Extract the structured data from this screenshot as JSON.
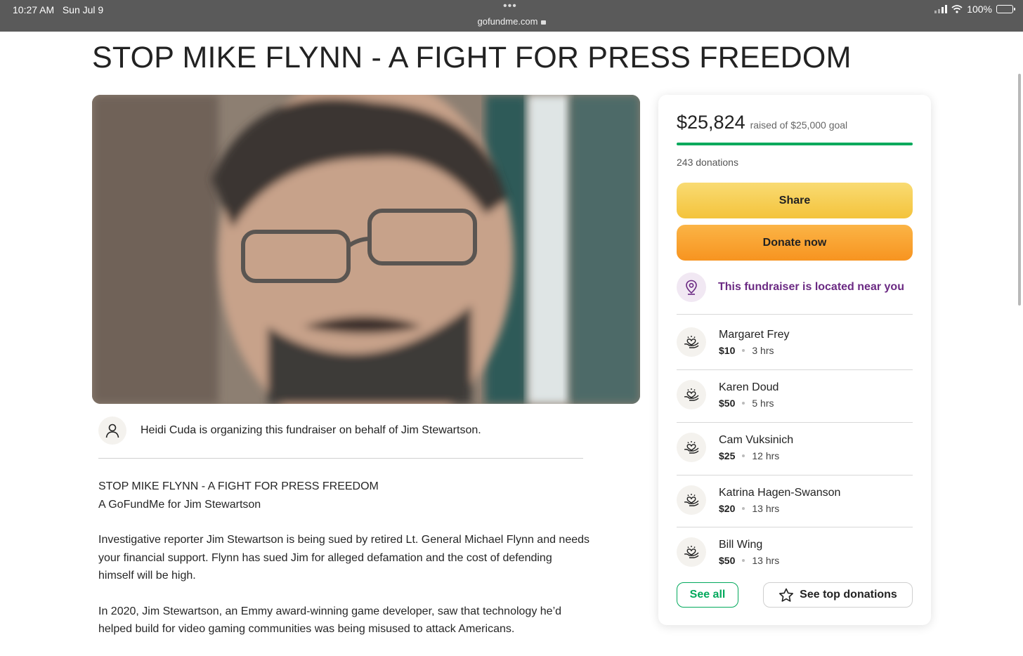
{
  "status_bar": {
    "time": "10:27 AM",
    "date": "Sun Jul 9",
    "url": "gofundme.com",
    "battery": "100%"
  },
  "page": {
    "title": "STOP MIKE FLYNN - A FIGHT FOR PRESS FREEDOM"
  },
  "organizer": {
    "text": "Heidi Cuda is organizing this fundraiser on behalf of Jim Stewartson."
  },
  "story": {
    "heading_line1": "STOP MIKE FLYNN - A FIGHT FOR PRESS FREEDOM",
    "heading_line2": "A GoFundMe for Jim Stewartson",
    "paragraph1": "Investigative reporter Jim Stewartson is being sued by retired Lt. General Michael Flynn and needs your financial support. Flynn has sued Jim for alleged defamation and the cost of defending himself will be high.",
    "paragraph2": "In 2020, Jim Stewartson, an Emmy award-winning game developer, saw that technology he’d helped build for video gaming communities was being misused to attack Americans."
  },
  "sidebar": {
    "amount_raised": "$25,824",
    "goal_text": "raised of $25,000 goal",
    "progress_fraction": 1.0,
    "donations_count": "243 donations",
    "share_label": "Share",
    "donate_label": "Donate now",
    "near_text": "This fundraiser is located near you",
    "donations": [
      {
        "name": "Margaret Frey",
        "amount": "$10",
        "time": "3 hrs"
      },
      {
        "name": "Karen Doud",
        "amount": "$50",
        "time": "5 hrs"
      },
      {
        "name": "Cam Vuksinich",
        "amount": "$25",
        "time": "12 hrs"
      },
      {
        "name": "Katrina Hagen-Swanson",
        "amount": "$20",
        "time": "13 hrs"
      },
      {
        "name": "Bill Wing",
        "amount": "$50",
        "time": "13 hrs"
      }
    ],
    "see_all_label": "See all",
    "see_top_label": "See top donations"
  },
  "colors": {
    "progress": "#02a95c",
    "share_button": "#f4c33b",
    "donate_button": "#f79420",
    "near_text": "#6b2a83"
  },
  "icons": {
    "avatar": "person-icon",
    "near": "location-pin-icon",
    "donor": "heart-hand-icon",
    "top_donations": "star-icon"
  }
}
